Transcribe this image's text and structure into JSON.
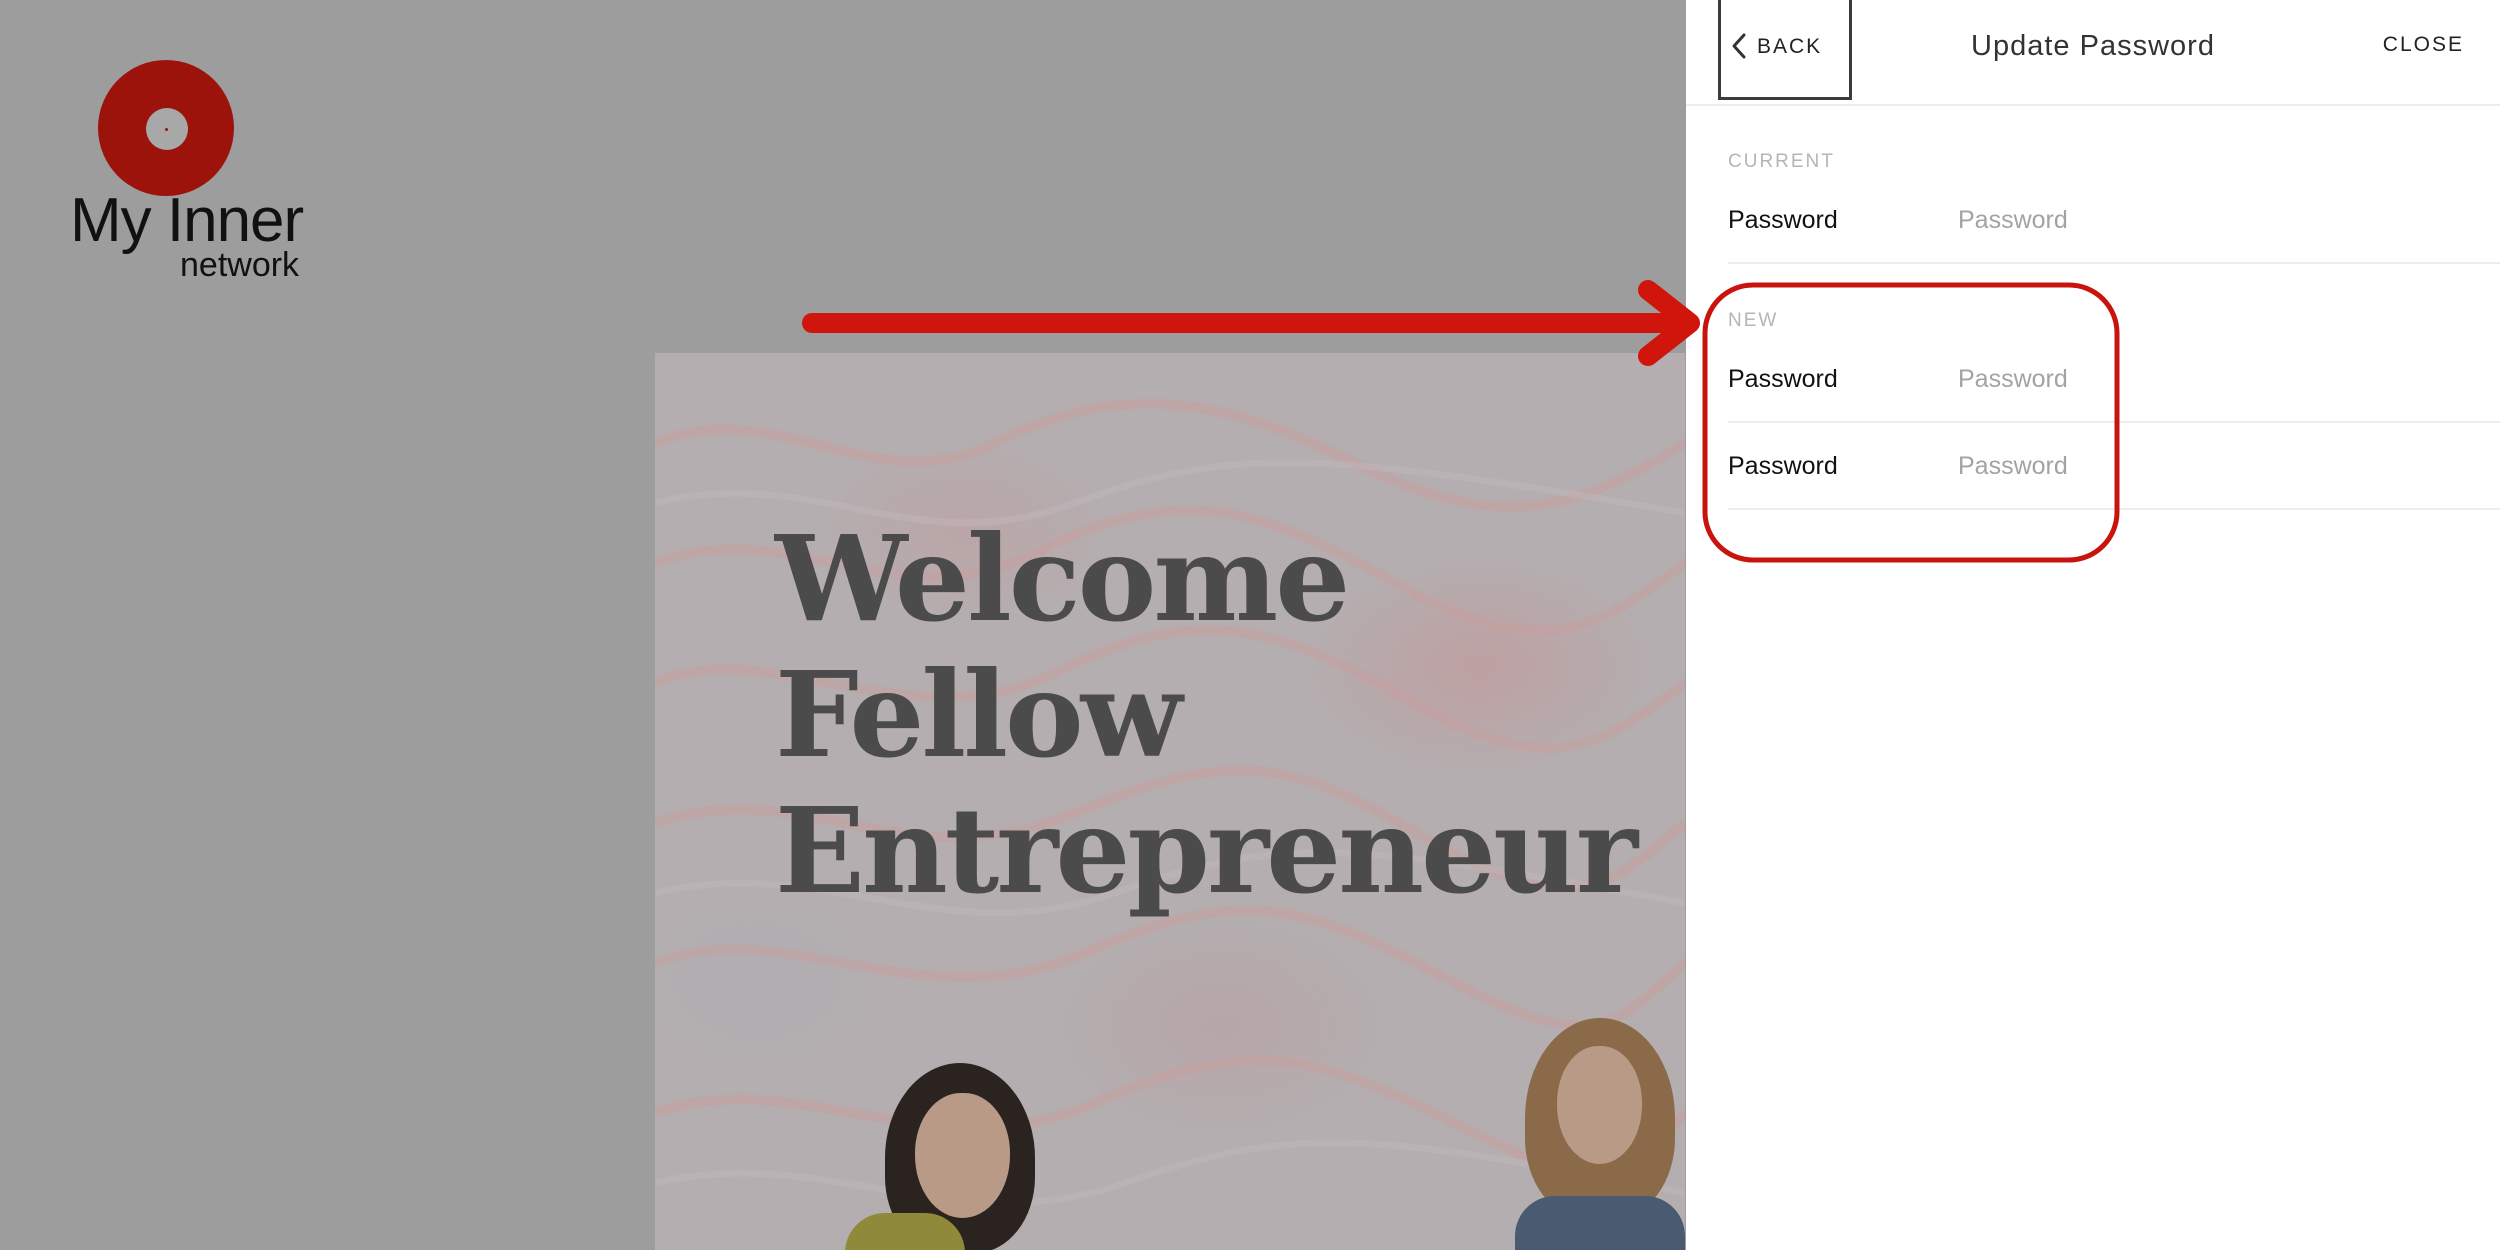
{
  "brand": {
    "name": "My Inner",
    "sub": "network"
  },
  "hero": {
    "title_lines": [
      "Welcome",
      "Fellow",
      "Entrepreneur"
    ]
  },
  "panel": {
    "back_label": "BACK",
    "title": "Update Password",
    "close_label": "CLOSE",
    "sections": [
      {
        "label": "CURRENT",
        "fields": [
          {
            "label": "Password",
            "placeholder": "Password"
          }
        ]
      },
      {
        "label": "NEW",
        "fields": [
          {
            "label": "Password",
            "placeholder": "Password"
          },
          {
            "label": "Password",
            "placeholder": "Password"
          }
        ]
      }
    ]
  },
  "colors": {
    "overlay": "#9d9d9d",
    "brand_red": "#9c130c",
    "annotation_red": "#d0150d",
    "panel_bg": "#ffffff"
  },
  "icons": {
    "back": "chevron-left-icon",
    "logo": "record-disc-icon"
  }
}
